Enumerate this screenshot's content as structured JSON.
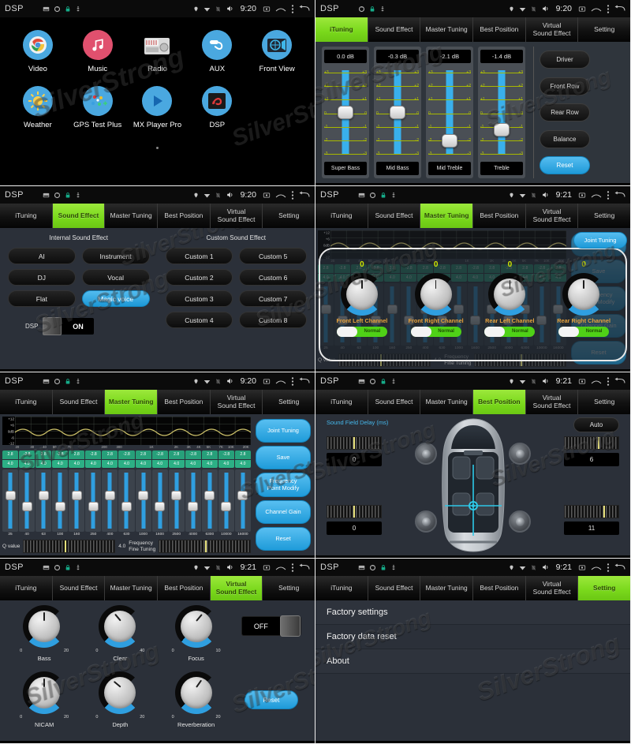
{
  "statusbar": {
    "title": "DSP",
    "times": {
      "a": "9:20",
      "b": "9:21"
    },
    "icons": [
      "sd-card-icon",
      "rotate-icon",
      "lock-icon",
      "usb-icon",
      "location-icon",
      "wifi-icon",
      "no-sim-icon",
      "volume-icon",
      "screenshot-icon",
      "home-icon",
      "menu-icon",
      "back-icon"
    ]
  },
  "tabs": [
    {
      "label": "iTuning"
    },
    {
      "label": "Sound Effect"
    },
    {
      "label": "Master Tuning"
    },
    {
      "label": "Best Position"
    },
    {
      "label": "Virtual",
      "label2": "Sound Effect"
    },
    {
      "label": "Setting"
    }
  ],
  "home": {
    "row1": [
      {
        "label": "Video",
        "icon": "video-icon"
      },
      {
        "label": "Music",
        "icon": "music-note-icon"
      },
      {
        "label": "Radio",
        "icon": "radio-icon"
      },
      {
        "label": "AUX",
        "icon": "aux-cable-icon"
      },
      {
        "label": "Front View",
        "icon": "camera-icon"
      }
    ],
    "row2": [
      {
        "label": "Weather",
        "icon": "sun-icon"
      },
      {
        "label": "GPS Test Plus",
        "icon": "satellite-icon"
      },
      {
        "label": "MX Player Pro",
        "icon": "play-icon"
      },
      {
        "label": "DSP",
        "icon": "dsp-icon"
      }
    ]
  },
  "ituning": {
    "sliders": [
      {
        "value": "0.0 dB",
        "name": "Super Bass",
        "pos": 0
      },
      {
        "value": "-0.3 dB",
        "name": "Mid Bass",
        "pos": 0
      },
      {
        "value": "-2.1 dB",
        "name": "Mid Treble",
        "pos": -2.1
      },
      {
        "value": "-1.4 dB",
        "name": "Treble",
        "pos": -1.4
      }
    ],
    "scale": [
      "+3",
      "+2",
      "+1",
      "0",
      "-1",
      "-2",
      "-3"
    ],
    "buttons": [
      "Driver",
      "Front Row",
      "Rear Row",
      "Balance"
    ],
    "reset": "Reset"
  },
  "sound_effect": {
    "internal_title": "Internal Sound Effect",
    "custom_title": "Custom Sound Effect",
    "internal": [
      "AI",
      "Instrument",
      "DJ",
      "Vocal",
      "Flat",
      "Magic voice"
    ],
    "internal_active": "Magic voice",
    "custom": [
      "Custom 1",
      "Custom 5",
      "Custom 2",
      "Custom 6",
      "Custom 3",
      "Custom 7",
      "Custom 4",
      "Custom 8"
    ],
    "dsp_label": "DSP",
    "dsp_state": "ON"
  },
  "master_tuning": {
    "graph": {
      "y_labels": [
        "+12",
        "+6",
        "0dB",
        "-6",
        "-12"
      ],
      "x_labels": [
        "20",
        "30",
        "40",
        "50",
        "70",
        "200",
        "300",
        "1K",
        "2K",
        "3K",
        "4K",
        "5K",
        "7K",
        "10K",
        "20K"
      ]
    },
    "bands": [
      {
        "gain": "2.8",
        "q": "4.0",
        "freq": "25"
      },
      {
        "gain": "-2.8",
        "q": "4.0",
        "freq": "40"
      },
      {
        "gain": "2.8",
        "q": "4.0",
        "freq": "63"
      },
      {
        "gain": "-2.8",
        "q": "4.0",
        "freq": "100"
      },
      {
        "gain": "2.8",
        "q": "4.0",
        "freq": "160"
      },
      {
        "gain": "-2.8",
        "q": "4.0",
        "freq": "250"
      },
      {
        "gain": "2.8",
        "q": "4.0",
        "freq": "400"
      },
      {
        "gain": "-2.8",
        "q": "4.0",
        "freq": "630"
      },
      {
        "gain": "2.8",
        "q": "4.0",
        "freq": "1000"
      },
      {
        "gain": "-2.8",
        "q": "4.0",
        "freq": "1600"
      },
      {
        "gain": "2.8",
        "q": "4.0",
        "freq": "2500"
      },
      {
        "gain": "-2.8",
        "q": "4.0",
        "freq": "4000"
      },
      {
        "gain": "2.8",
        "q": "4.0",
        "freq": "6300"
      },
      {
        "gain": "-2.8",
        "q": "4.0",
        "freq": "10000"
      },
      {
        "gain": "2.8",
        "q": "4.0",
        "freq": "16000"
      }
    ],
    "q_label": "Q value",
    "q_value": "4.0",
    "fine_label": "Frequency\nFine Tuning",
    "buttons": [
      "Joint Tuning",
      "Save",
      "Frequency Point Modify",
      "Channel Gain",
      "Reset"
    ],
    "btn_joint": "Joint Tuning",
    "btn_save": "Save",
    "btn_freq": "Frequency",
    "btn_freq2": "Point Modify",
    "btn_gain": "Channel Gain",
    "btn_reset": "Reset"
  },
  "channel_gain": {
    "channels": [
      {
        "name": "Front Left Channel",
        "value": "0",
        "switch": "Normal"
      },
      {
        "name": "Front Right Channel",
        "value": "0",
        "switch": "Normal"
      },
      {
        "name": "Rear Left Channel",
        "value": "0",
        "switch": "Normal"
      },
      {
        "name": "Rear Right Channel",
        "value": "0",
        "switch": "Normal"
      }
    ]
  },
  "best_position": {
    "title": "Sound Field Delay (ms)",
    "auto": "Auto",
    "values": {
      "front_left": "0",
      "front_right": "6",
      "rear_left": "0",
      "rear_right": "11"
    }
  },
  "virtual": {
    "knobs": [
      {
        "label": "Bass",
        "min": "0",
        "max": "20",
        "angle": 0
      },
      {
        "label": "Clear",
        "min": "0",
        "max": "40",
        "angle": -40
      },
      {
        "label": "Focus",
        "min": "0",
        "max": "10",
        "angle": 40
      },
      {
        "label": "NICAM",
        "min": "0",
        "max": "20",
        "angle": 0
      },
      {
        "label": "Depth",
        "min": "0",
        "max": "20",
        "angle": -50
      },
      {
        "label": "Reverberation",
        "min": "0",
        "max": "20",
        "angle": 35
      }
    ],
    "toggle_state": "OFF",
    "reset": "Reset"
  },
  "setting": {
    "items": [
      "Factory settings",
      "Factory data reset",
      "About"
    ]
  },
  "watermark": "SilverStrong",
  "colors": {
    "accent_green": "#7ed321",
    "accent_blue": "#2f9fe0",
    "panel_bg": "#2b3039",
    "status_bg": "#0b0b0b"
  }
}
